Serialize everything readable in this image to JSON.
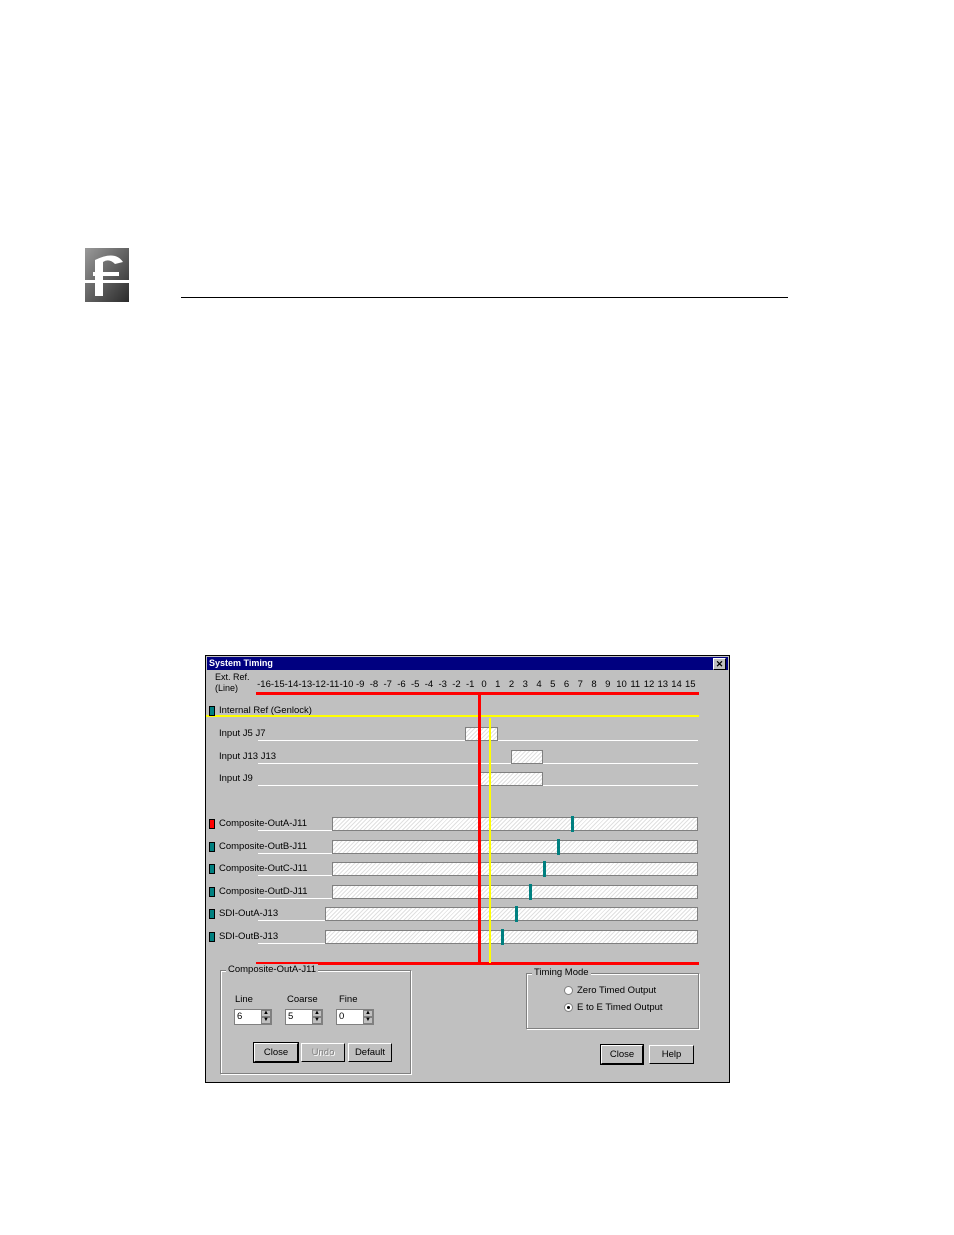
{
  "window": {
    "title": "System Timing",
    "close_glyph": "✕"
  },
  "ext_ref_label": [
    "Ext. Ref.",
    "(Line)"
  ],
  "ticks": [
    "-16",
    "-15",
    "-14",
    "-13",
    "-12",
    "-11",
    "-10",
    "-9",
    "-8",
    "-7",
    "-6",
    "-5",
    "-4",
    "-3",
    "-2",
    "-1",
    "0",
    "1",
    "2",
    "3",
    "4",
    "5",
    "6",
    "7",
    "8",
    "9",
    "10",
    "11",
    "12",
    "13",
    "14",
    "15"
  ],
  "rows": [
    {
      "label": "Internal Ref (Genlock)",
      "indicator": "#008080"
    },
    {
      "label": "Input J5 J7",
      "indicator": null
    },
    {
      "label": "Input J13 J13",
      "indicator": null
    },
    {
      "label": "Input J9",
      "indicator": null
    },
    {
      "label": "Composite-OutA-J11",
      "indicator": "#ff0000"
    },
    {
      "label": "Composite-OutB-J11",
      "indicator": "#008080"
    },
    {
      "label": "Composite-OutC-J11",
      "indicator": "#008080"
    },
    {
      "label": "Composite-OutD-J11",
      "indicator": "#008080"
    },
    {
      "label": "SDI-OutA-J13",
      "indicator": "#008080"
    },
    {
      "label": "SDI-OutB-J13",
      "indicator": "#008080"
    }
  ],
  "settings": {
    "group_title": "Composite-OutA-J11",
    "line_label": "Line",
    "line_value": "6",
    "coarse_label": "Coarse",
    "coarse_value": "5",
    "fine_label": "Fine",
    "fine_value": "0",
    "close": "Close",
    "undo": "Undo",
    "default": "Default"
  },
  "timing_mode": {
    "title": "Timing Mode",
    "option1": "Zero Timed Output",
    "option2": "E to E Timed Output",
    "selected": 2
  },
  "footer": {
    "close": "Close",
    "help": "Help"
  },
  "colors": {
    "titlebar": "#000080",
    "red": "#ff0000",
    "yellow": "#ffff00",
    "teal": "#008080",
    "face": "#c0c0c0"
  }
}
